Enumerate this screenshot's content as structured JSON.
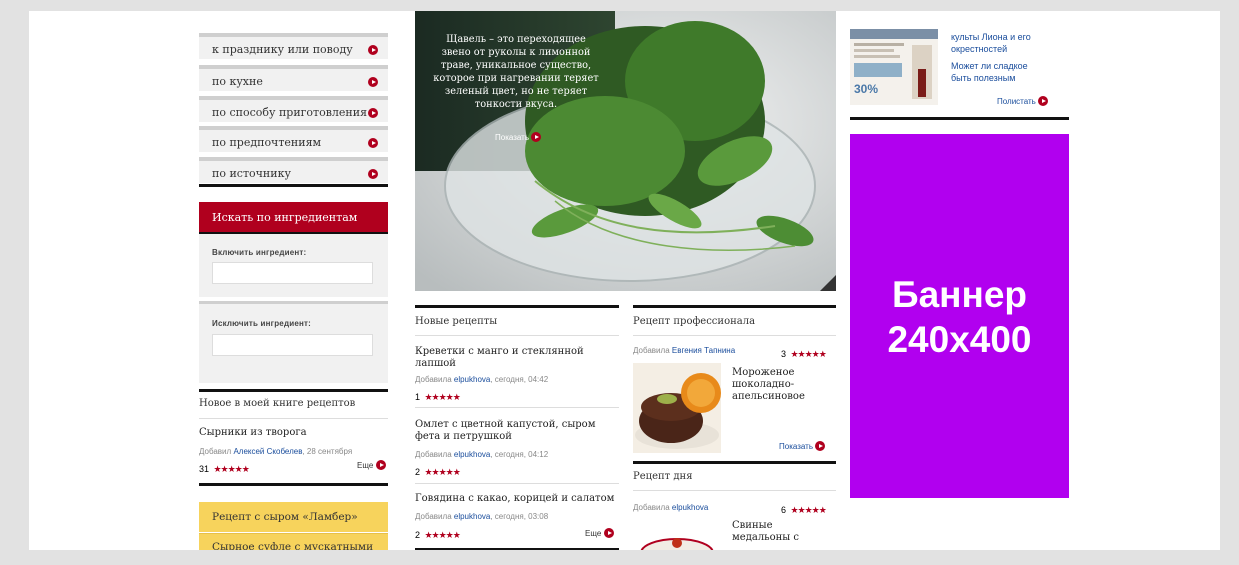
{
  "categories": [
    {
      "label": "к празднику или поводу"
    },
    {
      "label": "по кухне"
    },
    {
      "label": "по способу приготовления"
    },
    {
      "label": "по предпочтениям"
    },
    {
      "label": "по источнику"
    }
  ],
  "ingredients": {
    "title": "Искать по ингредиентам",
    "include_label": "Включить ингредиент:",
    "exclude_label": "Исключить ингредиент:",
    "include_value": "",
    "exclude_value": ""
  },
  "my_book": {
    "title": "Новое в моей книге рецептов",
    "recipe_title": "Сырники из творога",
    "added_prefix": "Добавил",
    "author": "Алексей Скобелев",
    "date": ", 28 сентября",
    "rating_count": "31",
    "stars": "★★★★★",
    "more_label": "Еще"
  },
  "promos": [
    {
      "label": "Рецепт с сыром «Ламбер»"
    },
    {
      "label": "Сырное суфле с мускатными"
    }
  ],
  "hero": {
    "text": "Щавель – это переходящее звено от руколы к лимонной траве, уникальное существо, которое при нагревании теряет зеленый цвет, но не теряет тонкости вкуса.",
    "show_label": "Показать"
  },
  "new_recipes": {
    "title": "Новые рецепты",
    "items": [
      {
        "title": "Креветки с манго и стеклянной лапшой",
        "added": "Добавила",
        "author": "elpukhova",
        "time": ", сегодня, 04:42",
        "count": "1",
        "stars": "★★★★★"
      },
      {
        "title": "Омлет с цветной капустой, сыром фета и петрушкой",
        "added": "Добавила",
        "author": "elpukhova",
        "time": ", сегодня, 04:12",
        "count": "2",
        "stars": "★★★★★"
      },
      {
        "title": "Говядина с какао, корицей и салатом",
        "added": "Добавила",
        "author": "elpukhova",
        "time": ", сегодня, 03:08",
        "count": "2",
        "stars": "★★★★★"
      }
    ],
    "more_label": "Еще"
  },
  "pro_recipe": {
    "title": "Рецепт профессионала",
    "added": "Добавила",
    "author": "Евгения Тапнина",
    "count": "3",
    "stars": "★★★★★",
    "recipe_title": "Мороженое шоколадно-апельсиновое",
    "show_label": "Показать"
  },
  "day_recipe": {
    "title": "Рецепт дня",
    "added": "Добавила",
    "author": "elpukhova",
    "count": "6",
    "stars": "★★★★★",
    "recipe_title": "Свиные медальоны с"
  },
  "magazine": {
    "line1": "культы Лиона и его",
    "line2": "окрестностей",
    "line3": "Может ли сладкое",
    "line4": "быть полезным",
    "read_label": "Полистать",
    "cover_badge": "30%"
  },
  "banner": {
    "line1": "Баннер",
    "line2": "240x400"
  },
  "colors": {
    "accent_red": "#b0001e",
    "banner_purple": "#b100ef",
    "promo_yellow": "#f7d35c",
    "link_blue": "#1a4d9c"
  }
}
